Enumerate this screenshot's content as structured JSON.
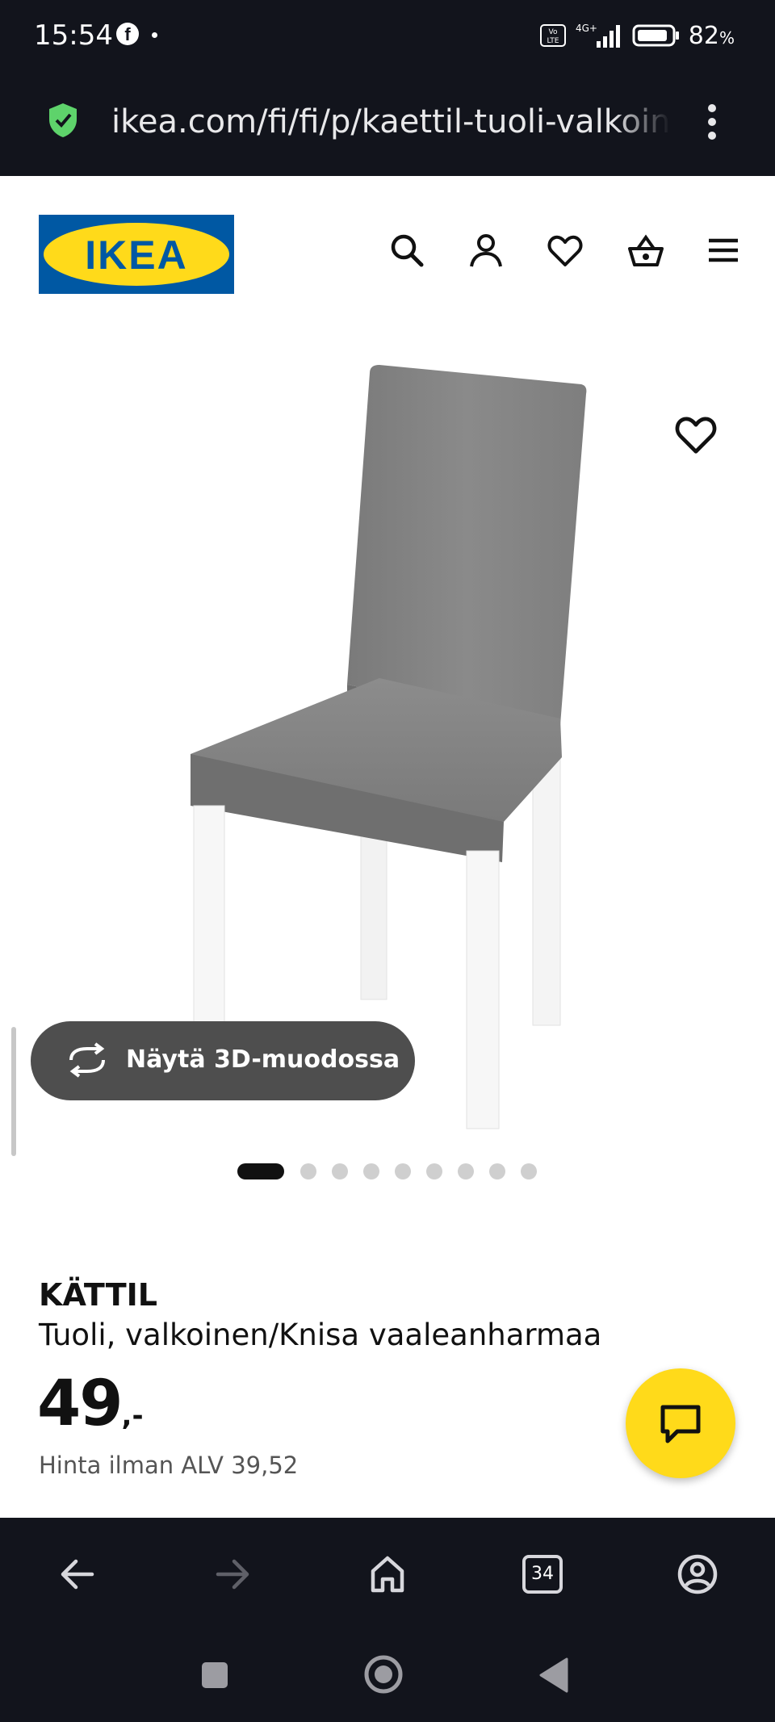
{
  "status_bar": {
    "time": "15:54",
    "facebook_icon": "facebook-icon",
    "network": "4G+",
    "volte": "Vo LTE",
    "battery": "82",
    "battery_unit": "%"
  },
  "browser": {
    "url": "ikea.com/fi/fi/p/kaettil-tuoli-valkoinen-knisa-vaaleanharmaa",
    "tab_count": "34",
    "secure_icon": "shield-check-icon"
  },
  "header": {
    "logo_text": "IKEA",
    "icons": [
      "search-icon",
      "user-icon",
      "heart-icon",
      "basket-icon",
      "menu-icon"
    ]
  },
  "gallery": {
    "view_3d_label": "Näytä 3D-muodossa",
    "image_count": 9,
    "active_index": 0
  },
  "product": {
    "name": "KÄTTIL",
    "description": "Tuoli, valkoinen/Knisa vaaleanharmaa",
    "price": "49",
    "price_suffix": ",-",
    "vat_text": "Hinta ilman ALV 39,52"
  },
  "colors": {
    "brand_blue": "#0058a3",
    "brand_yellow": "#ffda1a",
    "dark_bar": "#12141c",
    "secure_green": "#5ed36b"
  }
}
